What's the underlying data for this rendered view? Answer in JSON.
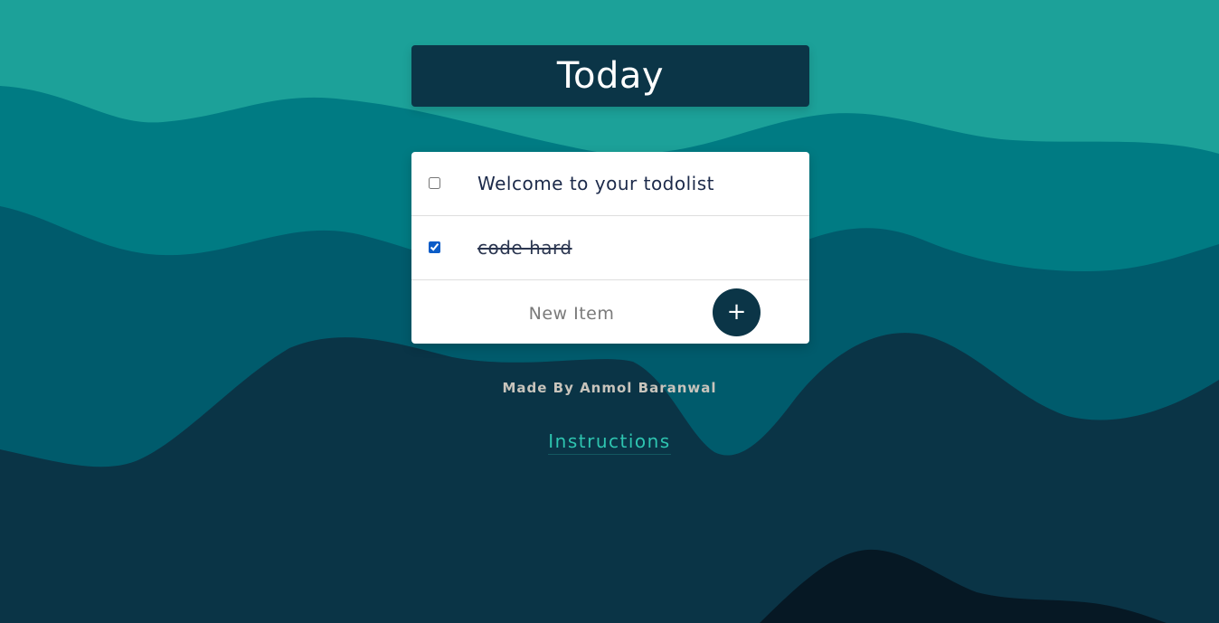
{
  "header": {
    "title": "Today"
  },
  "todo": {
    "items": [
      {
        "label": "Welcome to your todolist",
        "checked": false
      },
      {
        "label": "code hard",
        "checked": true
      }
    ],
    "new_item_placeholder": "New Item",
    "add_button_label": "+"
  },
  "footer": {
    "credit": "Made By Anmol Baranwal",
    "instructions_link": "Instructions"
  },
  "colors": {
    "header_bg": "#0b3547",
    "wave_light": "#1ca199",
    "wave_mid": "#007b83",
    "wave_deep": "#005b6c",
    "wave_dark": "#0a3446",
    "wave_darkest": "#061824",
    "link": "#2ec4b0"
  },
  "icons": {
    "add": "plus-icon"
  }
}
